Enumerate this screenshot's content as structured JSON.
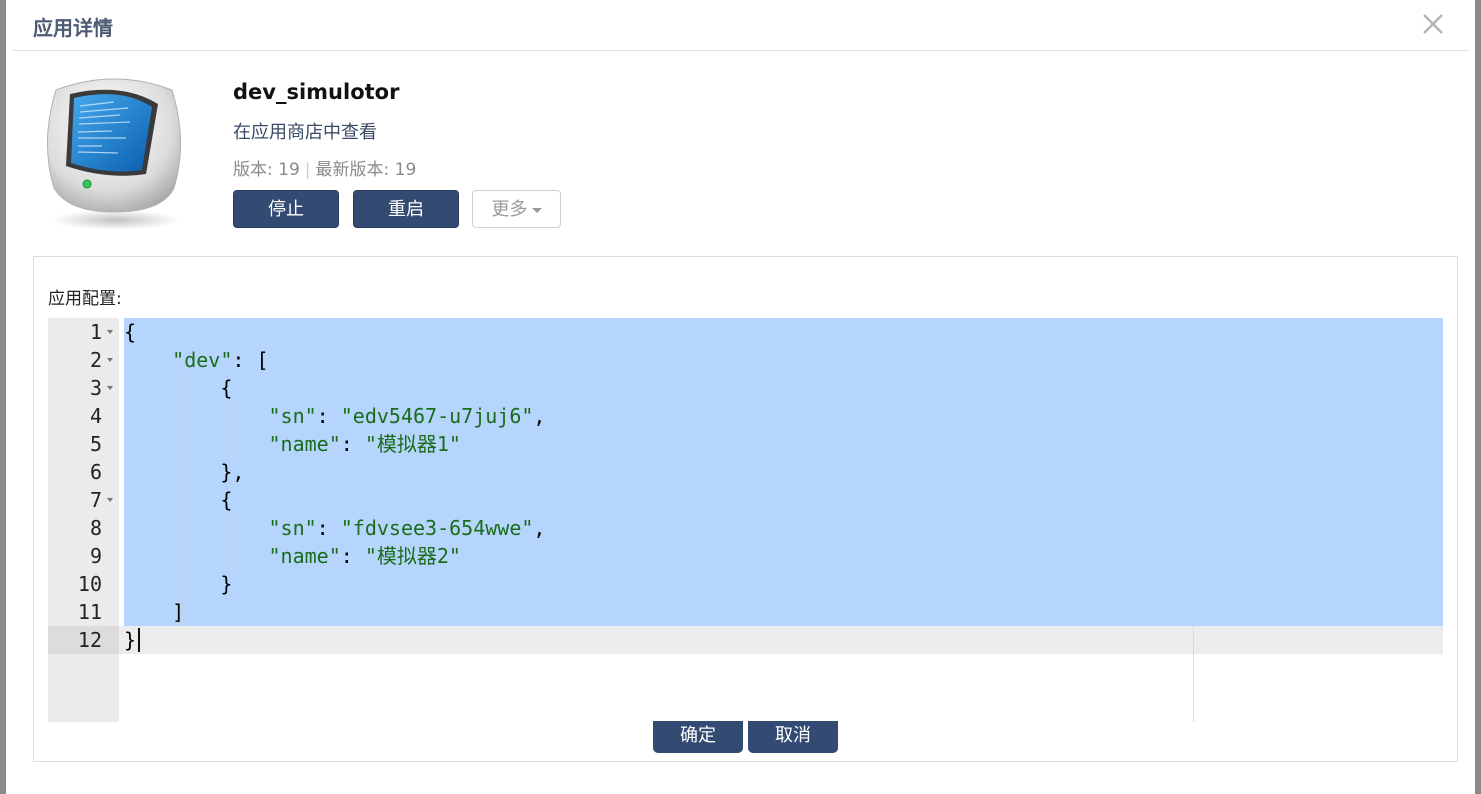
{
  "dialog": {
    "title": "应用详情",
    "close_icon": "close-icon"
  },
  "app": {
    "icon": "computer-monitor-icon",
    "name": "dev_simulotor",
    "store_link": "在应用商店中查看",
    "version_label": "版本:",
    "version": "19",
    "latest_version_label": "最新版本:",
    "latest_version": "19",
    "separator": "|"
  },
  "actions": {
    "stop_label": "停止",
    "restart_label": "重启",
    "more_label": "更多"
  },
  "config": {
    "label": "应用配置:",
    "line_numbers": [
      "1",
      "2",
      "3",
      "4",
      "5",
      "6",
      "7",
      "8",
      "9",
      "10",
      "11",
      "12"
    ],
    "lines": [
      "{",
      "    \"dev\": [",
      "        {",
      "            \"sn\": \"edv5467-u7juj6\",",
      "            \"name\": \"模拟器1\"",
      "        },",
      "        {",
      "            \"sn\": \"fdvsee3-654wwe\",",
      "            \"name\": \"模拟器2\"",
      "        }",
      "    ]",
      "}"
    ]
  },
  "footer": {
    "ok_label": "确定",
    "cancel_label": "取消"
  },
  "colors": {
    "primary": "#334a72",
    "selection": "#b5d5fc",
    "string": "#1a6c1a"
  }
}
